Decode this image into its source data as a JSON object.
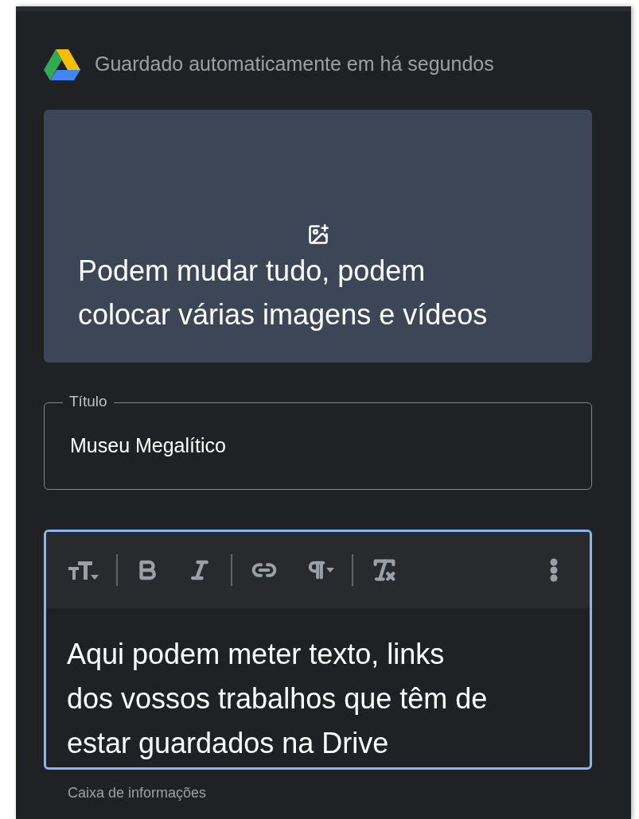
{
  "header": {
    "status": "Guardado automaticamente em há segundos"
  },
  "media": {
    "lines": [
      "Podem mudar tudo, podem",
      "colocar várias imagens e vídeos"
    ]
  },
  "title_field": {
    "label": "Título",
    "value": "Museu Megalítico"
  },
  "editor": {
    "focused": true,
    "lines": [
      "Aqui podem meter texto, links",
      "dos vossos trabalhos que têm de",
      "estar guardados na Drive"
    ]
  },
  "next_field": {
    "label": "Caixa de informações"
  }
}
